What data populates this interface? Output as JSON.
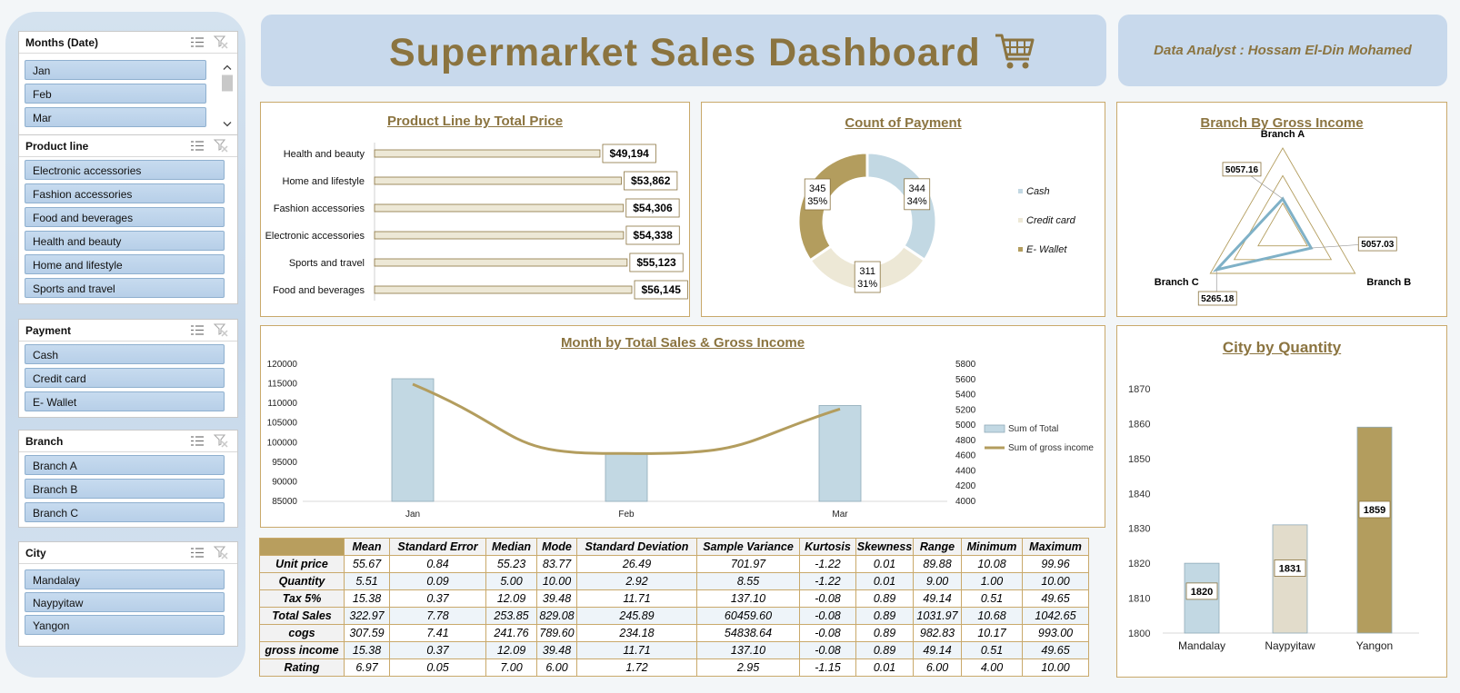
{
  "slicers": [
    {
      "title": "Months (Date)",
      "items": [
        "Jan",
        "Feb",
        "Mar"
      ],
      "has_scrollbar": true
    },
    {
      "title": "Product line",
      "items": [
        "Electronic accessories",
        "Fashion accessories",
        "Food and beverages",
        "Health and beauty",
        "Home and lifestyle",
        "Sports and travel"
      ]
    },
    {
      "title": "Payment",
      "items": [
        "Cash",
        "Credit card",
        "E- Wallet"
      ]
    },
    {
      "title": "Branch",
      "items": [
        "Branch A",
        "Branch B",
        "Branch C"
      ]
    },
    {
      "title": "City",
      "items": [
        "Mandalay",
        "Naypyitaw",
        "Yangon"
      ]
    }
  ],
  "header": {
    "title": "Supermarket Sales Dashboard",
    "analyst": "Data Analyst : Hossam El-Din Mohamed",
    "icon": "shopping-cart-icon"
  },
  "colors": {
    "gold": "#b39d5e",
    "gold_text": "#8b7440",
    "light_blue": "#c2d8e3",
    "beige": "#ede8d6",
    "slicer_blue": "#c7dbef",
    "panel_blue": "#c8d9ec"
  },
  "chart_data": [
    {
      "id": "product_line",
      "type": "bar",
      "orientation": "horizontal",
      "title": "Product Line by Total Price",
      "categories": [
        "Health and beauty",
        "Home and lifestyle",
        "Fashion accessories",
        "Electronic accessories",
        "Sports and travel",
        "Food and beverages"
      ],
      "values": [
        49194,
        53862,
        54306,
        54338,
        55123,
        56145
      ],
      "labels": [
        "$49,194",
        "$53,862",
        "$54,306",
        "$54,338",
        "$55,123",
        "$56,145"
      ]
    },
    {
      "id": "payment",
      "type": "pie",
      "variant": "doughnut",
      "title": "Count of Payment",
      "categories": [
        "Cash",
        "Credit card",
        "E- Wallet"
      ],
      "values": [
        344,
        311,
        345
      ],
      "percent_labels": [
        "34%",
        "31%",
        "35%"
      ],
      "colors": [
        "#c2d8e3",
        "#ede8d6",
        "#b39d5e"
      ]
    },
    {
      "id": "branch",
      "type": "radar",
      "title": "Branch By Gross Income",
      "categories": [
        "Branch A",
        "Branch B",
        "Branch C"
      ],
      "values": [
        5057.16,
        5057.03,
        5265.18
      ],
      "labels": [
        "5057.16",
        "5057.03",
        "5265.18"
      ]
    },
    {
      "id": "month",
      "type": "bar",
      "title": "Month by Total Sales & Gross Income",
      "categories": [
        "Jan",
        "Feb",
        "Mar"
      ],
      "series": [
        {
          "name": "Sum of Total",
          "type": "bar",
          "axis": "left",
          "values": [
            116291.87,
            97219.37,
            109455.51
          ]
        },
        {
          "name": "Sum of gross income",
          "type": "line",
          "axis": "right",
          "values": [
            5537.71,
            4629.49,
            5212.17
          ]
        }
      ],
      "left_ticks": [
        "120000",
        "115000",
        "110000",
        "105000",
        "100000",
        "95000",
        "90000",
        "85000"
      ],
      "right_ticks": [
        "5800",
        "5600",
        "5400",
        "5200",
        "5000",
        "4800",
        "4600",
        "4400",
        "4200",
        "4000"
      ],
      "ylim_left": [
        85000,
        120000
      ],
      "ylim_right": [
        4000,
        5800
      ],
      "legend": "right"
    },
    {
      "id": "city",
      "type": "bar",
      "title": "City by Quantity",
      "categories": [
        "Mandalay",
        "Naypyitaw",
        "Yangon"
      ],
      "values": [
        1820,
        1831,
        1859
      ],
      "labels": [
        "1820",
        "1831",
        "1859"
      ],
      "ticks": [
        "1870",
        "1860",
        "1850",
        "1840",
        "1830",
        "1820",
        "1810",
        "1800"
      ],
      "ylim": [
        1800,
        1870
      ],
      "colors": [
        "#c2d8e3",
        "#e2dccb",
        "#b39d5e"
      ]
    },
    {
      "id": "statistics",
      "type": "table",
      "columns": [
        "Mean",
        "Standard Error",
        "Median",
        "Mode",
        "Standard Deviation",
        "Sample Variance",
        "Kurtosis",
        "Skewness",
        "Range",
        "Minimum",
        "Maximum"
      ],
      "rows": [
        {
          "label": "Unit price",
          "values": [
            "55.67",
            "0.84",
            "55.23",
            "83.77",
            "26.49",
            "701.97",
            "-1.22",
            "0.01",
            "89.88",
            "10.08",
            "99.96"
          ]
        },
        {
          "label": "Quantity",
          "values": [
            "5.51",
            "0.09",
            "5.00",
            "10.00",
            "2.92",
            "8.55",
            "-1.22",
            "0.01",
            "9.00",
            "1.00",
            "10.00"
          ]
        },
        {
          "label": "Tax 5%",
          "values": [
            "15.38",
            "0.37",
            "12.09",
            "39.48",
            "11.71",
            "137.10",
            "-0.08",
            "0.89",
            "49.14",
            "0.51",
            "49.65"
          ]
        },
        {
          "label": "Total Sales",
          "values": [
            "322.97",
            "7.78",
            "253.85",
            "829.08",
            "245.89",
            "60459.60",
            "-0.08",
            "0.89",
            "1031.97",
            "10.68",
            "1042.65"
          ]
        },
        {
          "label": "cogs",
          "values": [
            "307.59",
            "7.41",
            "241.76",
            "789.60",
            "234.18",
            "54838.64",
            "-0.08",
            "0.89",
            "982.83",
            "10.17",
            "993.00"
          ]
        },
        {
          "label": "gross income",
          "values": [
            "15.38",
            "0.37",
            "12.09",
            "39.48",
            "11.71",
            "137.10",
            "-0.08",
            "0.89",
            "49.14",
            "0.51",
            "49.65"
          ]
        },
        {
          "label": "Rating",
          "values": [
            "6.97",
            "0.05",
            "7.00",
            "6.00",
            "1.72",
            "2.95",
            "-1.15",
            "0.01",
            "6.00",
            "4.00",
            "10.00"
          ]
        }
      ]
    }
  ]
}
